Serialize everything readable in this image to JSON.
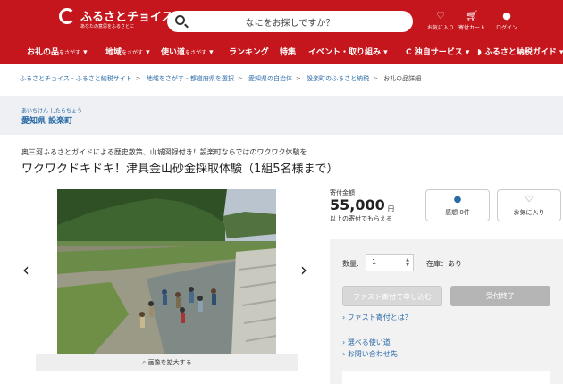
{
  "header": {
    "logo": "ふるさとチョイス",
    "tagline": "あなたの意思をふるさとに",
    "search_placeholder": "なにをお探しですか？",
    "favorites": "お気に入り",
    "cart": "寄付カート",
    "login": "ログイン"
  },
  "nav": [
    {
      "label": "お礼の品",
      "sub": "をさがす"
    },
    {
      "label": "地域",
      "sub": "をさがす"
    },
    {
      "label": "使い道",
      "sub": "をさがす"
    },
    {
      "label": "ランキング",
      "sub": ""
    },
    {
      "label": "特集",
      "sub": ""
    },
    {
      "label": "イベント・取り組み",
      "sub": ""
    },
    {
      "label": "独自サービス",
      "sub": ""
    },
    {
      "label": "ふるさと納税ガイド",
      "sub": ""
    }
  ],
  "breadcrumb": [
    "ふるさとチョイス - ふるさと納税サイト",
    "地域をさがす - 都道府県を選択",
    "愛知県の自治体",
    "設楽町のふるさと納税",
    "お礼の品詳細"
  ],
  "municipality": {
    "ruby": "あいちけん したらちょう",
    "name": "愛知県 設楽町"
  },
  "product": {
    "subtitle": "奥三河ふるさとガイドによる歴史散策、山城図録付き！設楽町ならではのワクワク体験を",
    "title": "ワクワクドキドキ！津具金山砂金採取体験（1組5名様まで）",
    "zoom_label": "画像を拡大する"
  },
  "donation": {
    "label": "寄付金額",
    "amount": "55,000",
    "unit": "円",
    "note": "以上の寄付でもらえる",
    "impressions": "感想 0件",
    "favorite": "お気に入り"
  },
  "order": {
    "qty_label": "数量:",
    "qty_value": "1",
    "stock": "在庫：あり",
    "fast_button": "ファスト寄付で申し込む",
    "closed_button": "受付終了",
    "links": [
      "ファスト寄付とは？",
      "選べる使い道",
      "お問い合わせ先"
    ]
  },
  "colors": {
    "brand": "#c4161c",
    "link": "#2a6aa8"
  }
}
